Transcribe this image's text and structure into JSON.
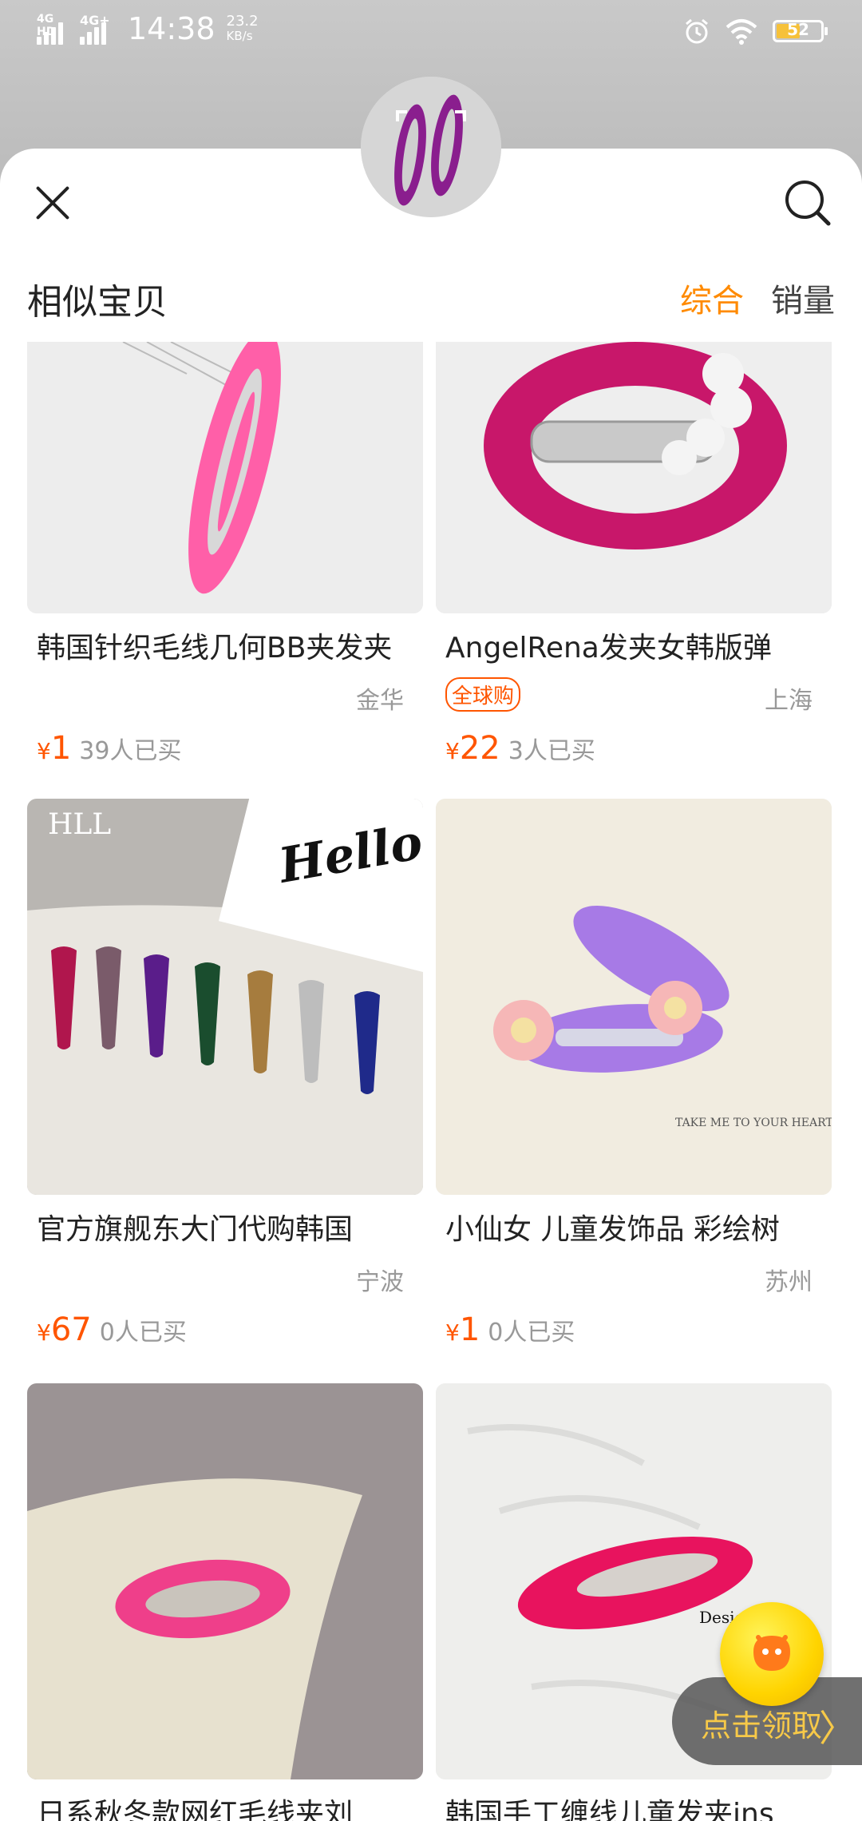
{
  "status_bar": {
    "signal1_label": "4G HD",
    "signal2_label": "4G+",
    "time": "14:38",
    "speed_value": "23.2",
    "speed_unit": "KB/s",
    "battery": "52",
    "icons": [
      "alarm-icon",
      "wifi-icon",
      "battery-icon"
    ]
  },
  "header": {
    "title": "相似宝贝",
    "sort_tabs": [
      {
        "label": "综合",
        "active": true
      },
      {
        "label": "销量",
        "active": false
      }
    ]
  },
  "products": [
    {
      "title": "韩国针织毛线几何BB夹发夹",
      "badge": "",
      "location": "金华",
      "currency": "¥",
      "price": "1",
      "sold": "39人已买"
    },
    {
      "title": "AngelRena发夹女韩版弹",
      "badge": "全球购",
      "location": "上海",
      "currency": "¥",
      "price": "22",
      "sold": "3人已买"
    },
    {
      "title": "官方旗舰东大门代购韩国",
      "badge": "",
      "location": "宁波",
      "currency": "¥",
      "price": "67",
      "sold": "0人已买"
    },
    {
      "title": "小仙女 儿童发饰品 彩绘树",
      "badge": "",
      "location": "苏州",
      "currency": "¥",
      "price": "1",
      "sold": "0人已买"
    },
    {
      "title": "日系秋冬款网红毛线夹刘",
      "badge": "",
      "location": "",
      "currency": "",
      "price": "",
      "sold": ""
    },
    {
      "title": "韩国手工缠线儿童发夹ins",
      "badge": "",
      "location": "",
      "currency": "",
      "price": "",
      "sold": ""
    }
  ],
  "image_text": {
    "p3_brand": "HLL",
    "p3_card": "Hello",
    "p4_caption": "TAKE ME TO YOUR HEART",
    "p6_caption": "Design"
  },
  "promo": {
    "label": "点击领取"
  }
}
